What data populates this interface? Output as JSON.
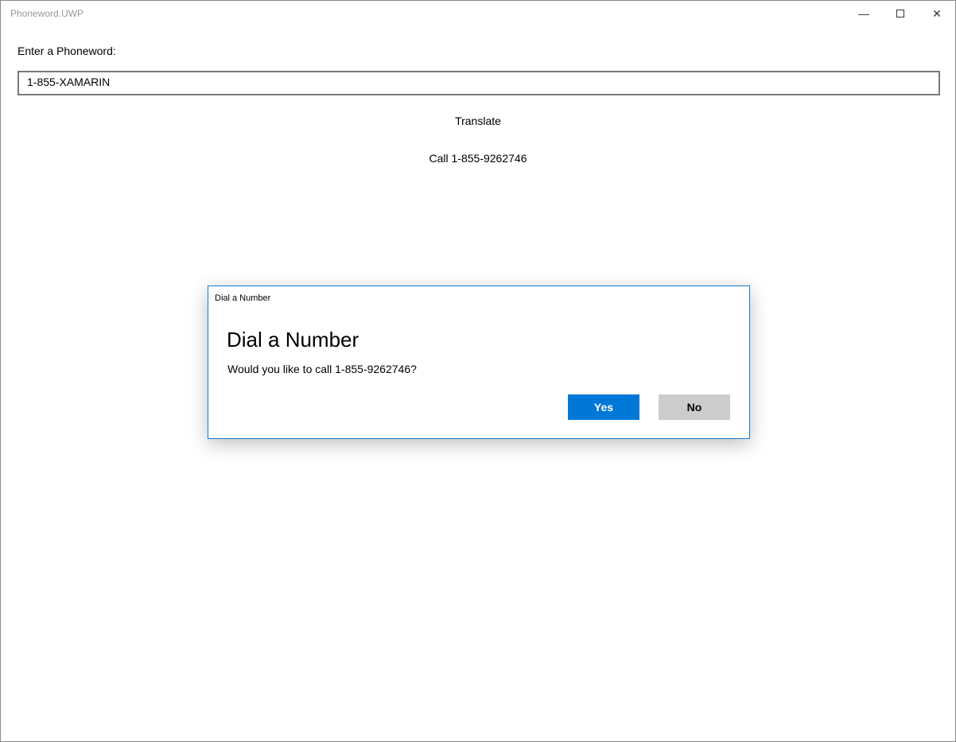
{
  "window": {
    "title": "Phoneword.UWP",
    "minimize_icon": "minimize-icon",
    "maximize_icon": "maximize-icon",
    "close_icon": "close-icon"
  },
  "main": {
    "prompt_label": "Enter a Phoneword:",
    "phoneword_value": "1-855-XAMARIN",
    "translate_label": "Translate",
    "call_label": "Call 1-855-9262746"
  },
  "dialog": {
    "caption": "Dial a Number",
    "title": "Dial a Number",
    "message": "Would you like to call 1-855-9262746?",
    "yes_label": "Yes",
    "no_label": "No",
    "accent": "#0078d7"
  }
}
